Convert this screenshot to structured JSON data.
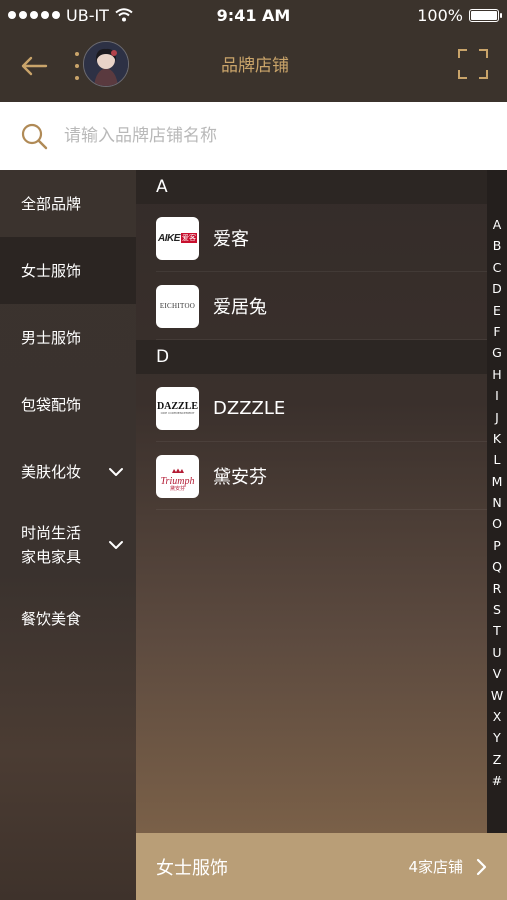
{
  "status_bar": {
    "carrier": "UB-IT",
    "time": "9:41 AM",
    "battery": "100%",
    "battery_level": 1.0
  },
  "nav": {
    "title": "品牌店铺"
  },
  "search": {
    "placeholder": "请输入品牌店铺名称"
  },
  "sidebar": {
    "items": [
      {
        "label": "全部品牌"
      },
      {
        "label": "女士服饰"
      },
      {
        "label": "男士服饰"
      },
      {
        "label": "包袋配饰"
      },
      {
        "label": "美肤化妆"
      },
      {
        "label_line1": "时尚生活",
        "label_line2": "家电家具"
      },
      {
        "label": "餐饮美食"
      }
    ],
    "active_index": 1
  },
  "sections": [
    {
      "letter": "A",
      "brands": [
        {
          "name": "爱客",
          "logo_text": "AIKE",
          "logo_text_cn": "爱客"
        },
        {
          "name": "爱居兔",
          "logo_text": "EICHITOO"
        }
      ]
    },
    {
      "letter": "D",
      "brands": [
        {
          "name": "DZZZLE",
          "logo_text": "DAZZLE",
          "logo_subtext": "ODE COMMENCEMENT"
        },
        {
          "name": "黛安芬",
          "logo_text": "Triumph",
          "logo_subtext": "黛安芬"
        }
      ]
    }
  ],
  "index_letters": [
    "A",
    "B",
    "C",
    "D",
    "E",
    "F",
    "G",
    "H",
    "I",
    "J",
    "K",
    "L",
    "M",
    "N",
    "O",
    "P",
    "Q",
    "R",
    "S",
    "T",
    "U",
    "V",
    "W",
    "X",
    "Y",
    "Z",
    "#"
  ],
  "footer": {
    "category": "女士服饰",
    "count": "4家店铺"
  },
  "colors": {
    "accent": "#c9a46a",
    "footer": "#b99e77",
    "bar": "#3b332c"
  },
  "icons": {
    "back": "arrow-left-icon",
    "menu": "vertical-dots-icon",
    "scan": "scan-frame-icon",
    "search": "search-icon",
    "chevron": "chevron-down-icon",
    "footer": "chevron-right-icon"
  }
}
